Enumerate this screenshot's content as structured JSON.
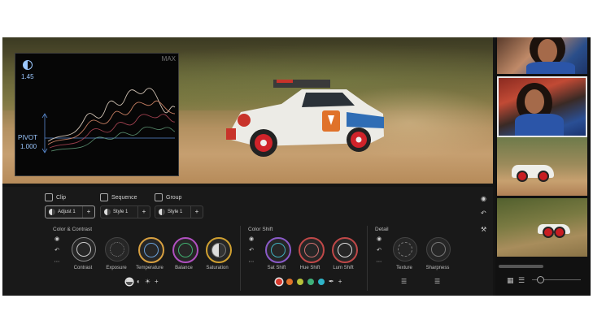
{
  "scope": {
    "max_label": "MAX",
    "top_value": "1.45",
    "pivot_label": "PIVOT",
    "pivot_value": "1.000"
  },
  "layers": {
    "tabs": [
      {
        "label": "Clip",
        "icon": "clip-icon"
      },
      {
        "label": "Sequence",
        "icon": "sequence-icon"
      },
      {
        "label": "Group",
        "icon": "group-icon"
      }
    ],
    "chips": [
      {
        "label": "Adjust 1",
        "active": true
      },
      {
        "label": "Style 1",
        "active": false
      },
      {
        "label": "Style 1",
        "active": false
      }
    ]
  },
  "sections": {
    "color_contrast": {
      "title": "Color & Contrast",
      "knobs": [
        "Contrast",
        "Exposure",
        "Temperature",
        "Balance",
        "Saturation"
      ]
    },
    "color_shift": {
      "title": "Color Shift",
      "knobs": [
        "Sat Shift",
        "Hue Shift",
        "Lum Shift"
      ]
    },
    "detail": {
      "title": "Detail",
      "knobs": [
        "Texture",
        "Sharpness"
      ]
    }
  },
  "colors": {
    "accent_blue": "#9cc8ff",
    "red": "#d83a2e",
    "orange": "#e0722a",
    "yellow_green": "#b8c23a",
    "green": "#3fb07a",
    "cyan": "#2fb4c8",
    "panel_bg": "#191919"
  }
}
